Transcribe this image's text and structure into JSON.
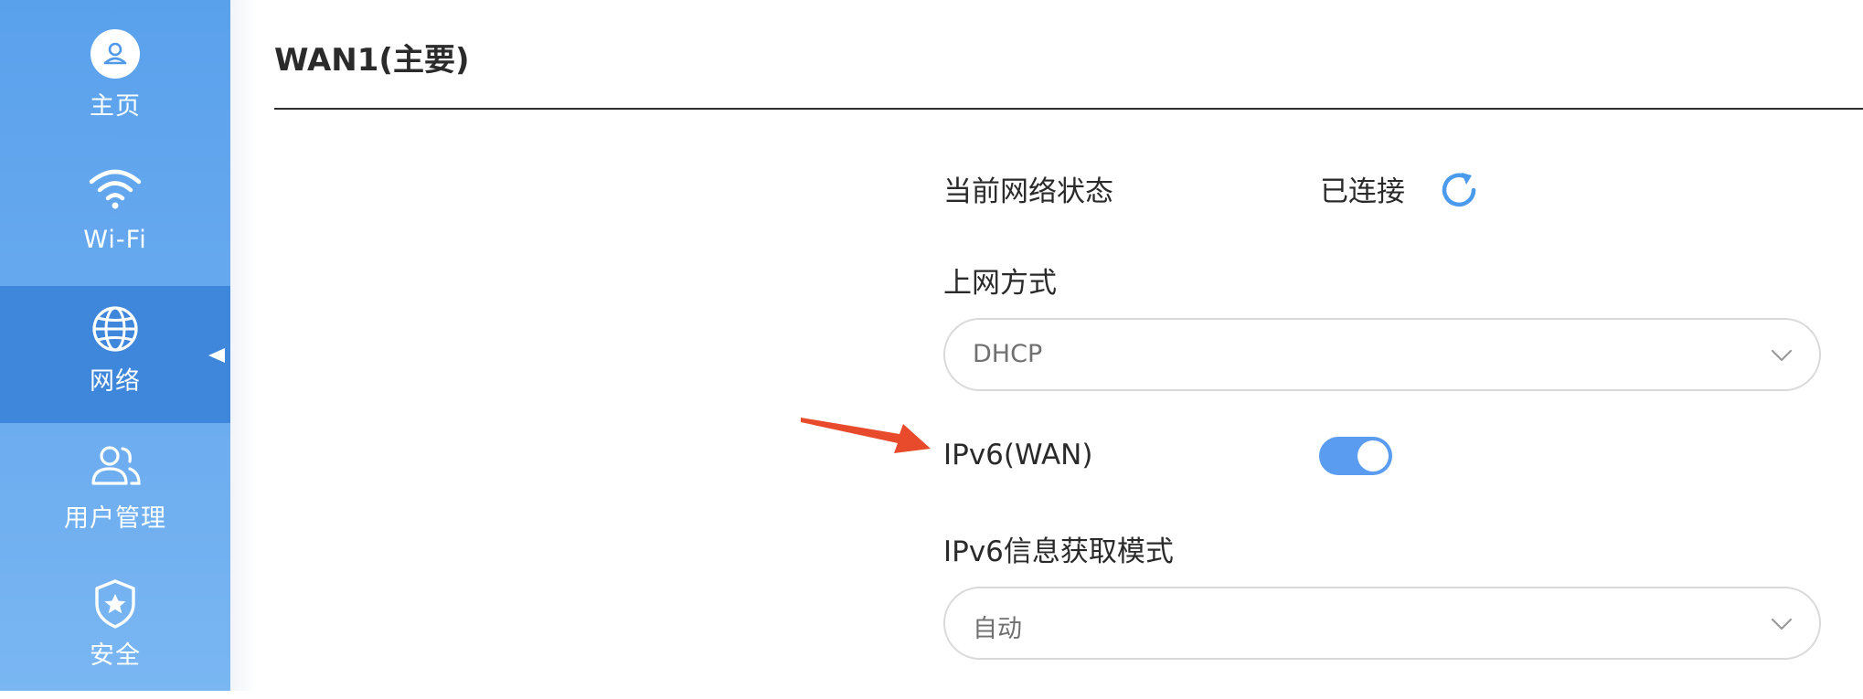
{
  "sidebar": {
    "items": [
      {
        "label": "主页",
        "icon": "home-user-icon"
      },
      {
        "label": "Wi-Fi",
        "icon": "wifi-icon"
      },
      {
        "label": "网络",
        "icon": "globe-icon",
        "active": true
      },
      {
        "label": "用户管理",
        "icon": "users-icon"
      },
      {
        "label": "安全",
        "icon": "shield-star-icon"
      }
    ]
  },
  "page": {
    "title": "WAN1(主要)"
  },
  "form": {
    "network_status_label": "当前网络状态",
    "network_status_value": "已连接",
    "connection_type_label": "上网方式",
    "connection_type_value": "DHCP",
    "ipv6_wan_label": "IPv6(WAN)",
    "ipv6_wan_enabled": true,
    "ipv6_mode_label": "IPv6信息获取模式",
    "ipv6_mode_value": "自动"
  },
  "colors": {
    "sidebar": "#5aa1ec",
    "sidebar_active": "#3f87db",
    "accent": "#5a9cf0",
    "annotation_arrow": "#e84a2c"
  }
}
